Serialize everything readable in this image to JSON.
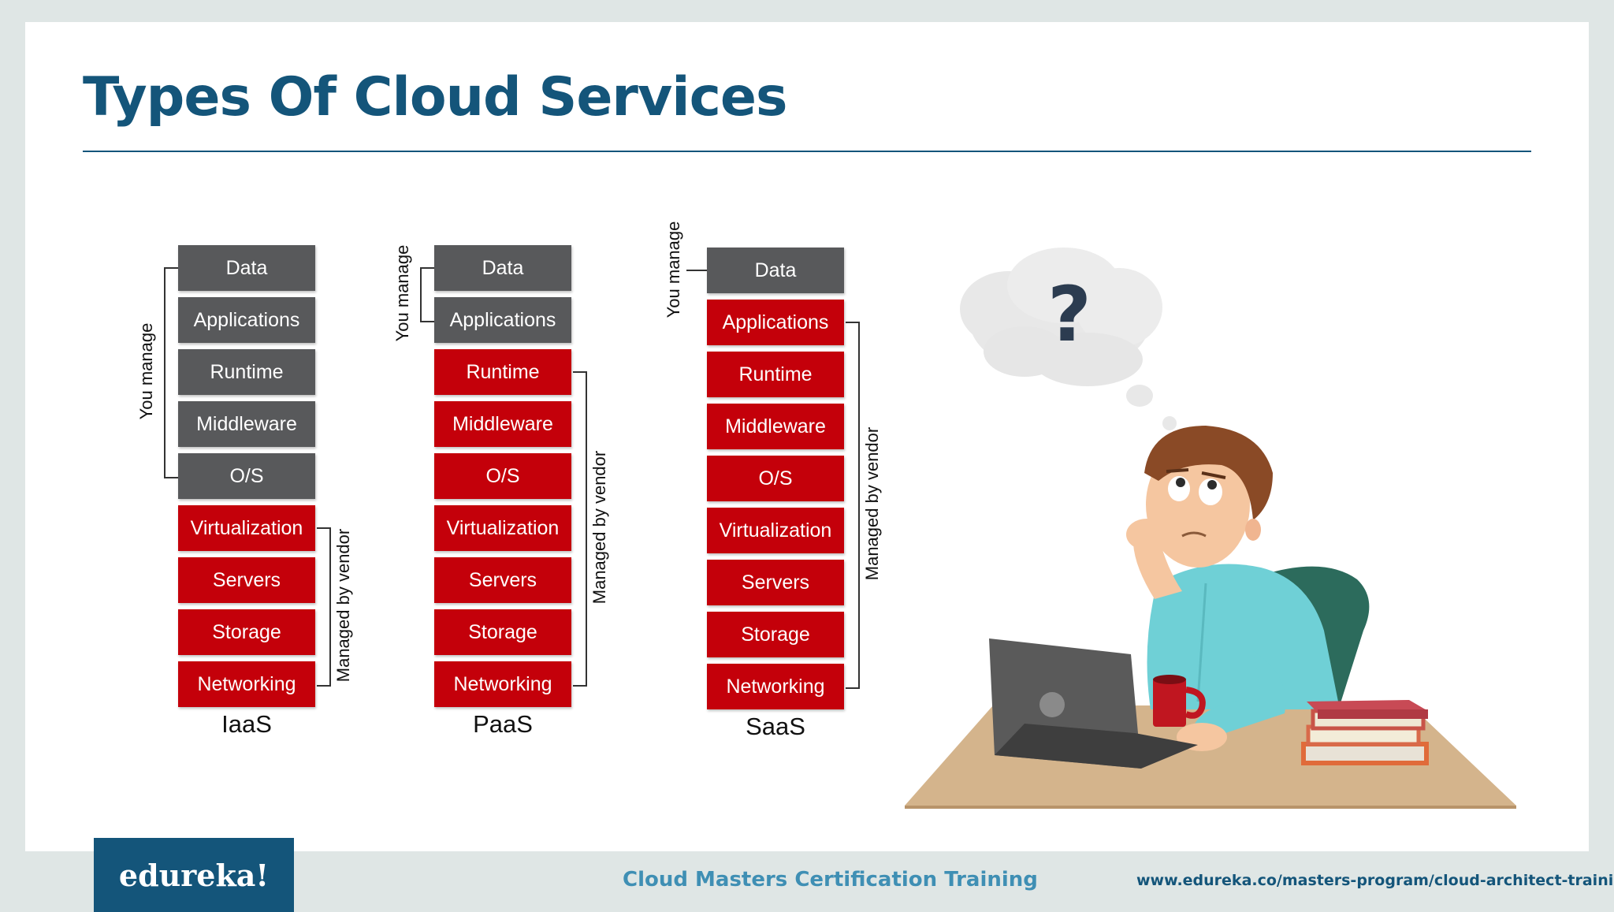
{
  "slide": {
    "title": "Types Of Cloud Services"
  },
  "stacks": [
    {
      "name": "IaaS",
      "label": "IaaS",
      "layers": [
        "Data",
        "Applications",
        "Runtime",
        "Middleware",
        "O/S",
        "Virtualization",
        "Servers",
        "Storage",
        "Networking"
      ],
      "you_manage_count": 5,
      "you_manage_label": "You manage",
      "vendor_label": "Managed by vendor"
    },
    {
      "name": "PaaS",
      "label": "PaaS",
      "layers": [
        "Data",
        "Applications",
        "Runtime",
        "Middleware",
        "O/S",
        "Virtualization",
        "Servers",
        "Storage",
        "Networking"
      ],
      "you_manage_count": 2,
      "you_manage_label": "You manage",
      "vendor_label": "Managed by vendor"
    },
    {
      "name": "SaaS",
      "label": "SaaS",
      "layers": [
        "Data",
        "Applications",
        "Runtime",
        "Middleware",
        "O/S",
        "Virtualization",
        "Servers",
        "Storage",
        "Networking"
      ],
      "you_manage_count": 1,
      "you_manage_label": "You manage",
      "vendor_label": "Managed by vendor"
    }
  ],
  "illustration": {
    "thought_symbol": "?",
    "description_icon": "confused-man-at-laptop-illustration"
  },
  "footer": {
    "logo_text": "edureka!",
    "course": "Cloud Masters Certification Training",
    "url": "www.edureka.co/masters-program/cloud-architect-training"
  },
  "colors": {
    "title": "#14557a",
    "user_layer": "#58595b",
    "vendor_layer": "#c4000a",
    "footer_blue": "#14557a",
    "footer_text": "#3f8fb4",
    "background": "#dfe6e5"
  }
}
